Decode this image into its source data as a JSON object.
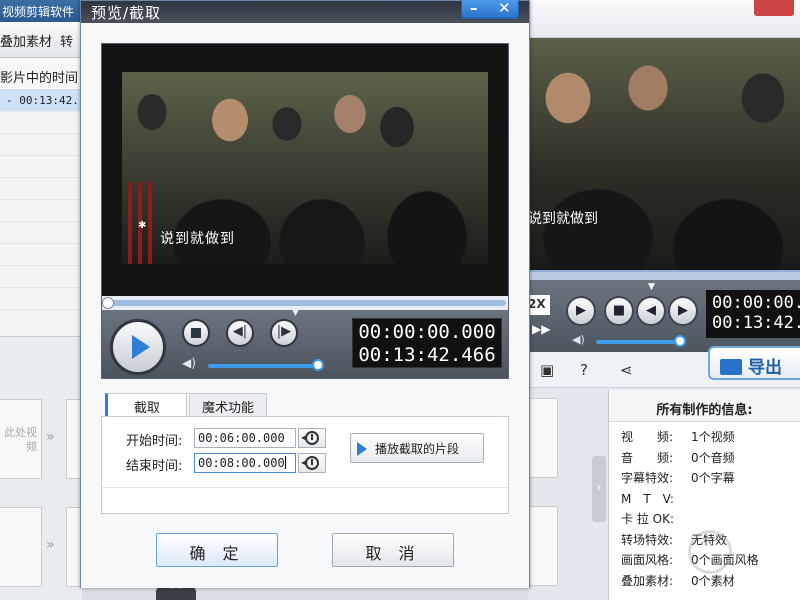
{
  "background_app": {
    "title": "视频剪辑软件",
    "toolbar": [
      "叠加素材",
      "转"
    ],
    "column_header": "影片中的时间",
    "selected_row_time": "- 00:13:42.",
    "card_text": "此处视频",
    "speed_label": "2X",
    "time_current": "00:00:00.",
    "time_total": "00:13:42.",
    "subtitle": "说到就做到",
    "export_label": "导出",
    "info": {
      "heading": "所有制作的信息:",
      "rows": [
        {
          "key": "视　　频:",
          "value": "1个视频"
        },
        {
          "key": "音　　频:",
          "value": "0个音频"
        },
        {
          "key": "字幕特效:",
          "value": "0个字幕"
        },
        {
          "key": "M　T　V:",
          "value": ""
        },
        {
          "key": "卡 拉 OK:",
          "value": ""
        },
        {
          "key": "转场特效:",
          "value": "无特效"
        },
        {
          "key": "画面风格:",
          "value": "0个画面风格"
        },
        {
          "key": "叠加素材:",
          "value": "0个素材"
        }
      ]
    }
  },
  "dialog": {
    "title": "预览/截取",
    "minimize_glyph": "–",
    "close_glyph": "✕",
    "player": {
      "subtitle": "说到就做到",
      "current_time": "00:00:00.000",
      "total_time": "00:13:42.466",
      "progress": 0,
      "volume": 0.9
    },
    "tabs": [
      {
        "label": "截取",
        "active": true
      },
      {
        "label": "魔术功能",
        "active": false
      }
    ],
    "clip": {
      "start_label": "开始时间:",
      "start_value": "00:06:00.000",
      "end_label": "结束时间:",
      "end_value": "00:08:00.000",
      "play_button": "播放截取的片段"
    },
    "buttons": {
      "ok": "确 定",
      "cancel": "取 消"
    }
  },
  "colors": {
    "accent": "#2d7fd6",
    "title_bar": "#2f3540",
    "volume": "#3f9bea"
  }
}
